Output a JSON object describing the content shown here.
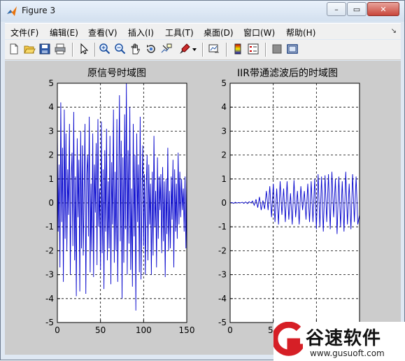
{
  "window": {
    "title": "Figure 3",
    "min_symbol": "–",
    "max_symbol": "▭",
    "close_symbol": "✕"
  },
  "menu": {
    "items": [
      "文件(F)",
      "编辑(E)",
      "查看(V)",
      "插入(I)",
      "工具(T)",
      "桌面(D)",
      "窗口(W)",
      "帮助(H)"
    ],
    "more_symbol": "↘"
  },
  "toolbar": {
    "icons": [
      "new-figure-icon",
      "open-file-icon",
      "save-icon",
      "print-icon",
      "edit-plot-arrow-icon",
      "zoom-in-icon",
      "zoom-out-icon",
      "pan-hand-icon",
      "rotate-3d-icon",
      "data-cursor-icon",
      "brush-icon",
      "brush-dropdown-icon",
      "link-plot-icon",
      "insert-colorbar-icon",
      "insert-legend-icon",
      "hide-plot-tools-icon",
      "show-plot-tools-icon"
    ]
  },
  "chart_data": [
    {
      "type": "line",
      "title": "原信号时域图",
      "xlim": [
        0,
        150
      ],
      "ylim": [
        -5,
        5
      ],
      "xticks": [
        "0",
        "50",
        "100",
        "150"
      ],
      "yticks": [
        "5",
        "4",
        "3",
        "2",
        "1",
        "0",
        "-1",
        "-2",
        "-3",
        "-4",
        "-5"
      ],
      "grid": true,
      "line_color": "#0000cc",
      "series": [
        {
          "x": [
            0,
            1,
            2,
            3,
            4,
            5,
            6,
            7,
            8,
            9,
            10,
            11,
            12,
            13,
            14,
            15,
            16,
            17,
            18,
            19,
            20,
            21,
            22,
            23,
            24,
            25,
            26,
            27,
            28,
            29,
            30,
            31,
            32,
            33,
            34,
            35,
            36,
            37,
            38,
            39,
            40,
            41,
            42,
            43,
            44,
            45,
            46,
            47,
            48,
            49,
            50,
            51,
            52,
            53,
            54,
            55,
            56,
            57,
            58,
            59,
            60,
            61,
            62,
            63,
            64,
            65,
            66,
            67,
            68,
            69,
            70,
            71,
            72,
            73,
            74,
            75,
            76,
            77,
            78,
            79,
            80,
            81,
            82,
            83,
            84,
            85,
            86,
            87,
            88,
            89,
            90,
            91,
            92,
            93,
            94,
            95,
            96,
            97,
            98,
            99,
            100,
            101,
            102,
            103,
            104,
            105,
            106,
            107,
            108,
            109,
            110,
            111,
            112,
            113,
            114,
            115,
            116,
            117,
            118,
            119,
            120,
            121,
            122,
            123,
            124,
            125,
            126,
            127,
            128,
            129,
            130,
            131,
            132,
            133,
            134,
            135,
            136,
            137,
            138,
            139,
            140,
            141,
            142,
            143,
            144,
            145,
            146,
            147,
            148,
            149,
            150
          ],
          "y": [
            3.1,
            -1.2,
            1.6,
            -2.7,
            4.2,
            -0.8,
            2.3,
            -3.3,
            3.9,
            -1.5,
            2.9,
            -2.0,
            1.4,
            -0.5,
            3.3,
            -3.0,
            0.9,
            2.1,
            -1.8,
            3.8,
            -2.4,
            1.1,
            -3.9,
            2.7,
            -0.6,
            1.8,
            -3.7,
            3.0,
            -1.9,
            2.4,
            -2.2,
            0.4,
            3.3,
            -3.8,
            1.2,
            2.0,
            -1.4,
            3.6,
            -2.9,
            0.8,
            -2.0,
            2.9,
            -3.1,
            1.6,
            -0.4,
            2.5,
            -2.6,
            3.5,
            -1.0,
            0.6,
            -2.8,
            3.4,
            -2.1,
            1.4,
            -3.6,
            2.2,
            -1.2,
            3.1,
            -2.4,
            0.9,
            -1.9,
            2.8,
            -3.4,
            1.7,
            -0.9,
            3.9,
            -2.5,
            1.3,
            -2.0,
            3.5,
            -3.3,
            0.7,
            4.5,
            -1.6,
            2.6,
            -4.0,
            1.9,
            -2.5,
            3.7,
            -1.1,
            5.0,
            -3.0,
            2.2,
            -1.7,
            4.0,
            -2.8,
            0.6,
            -3.5,
            3.3,
            -1.4,
            2.0,
            -4.5,
            2.9,
            -0.8,
            1.6,
            -2.9,
            3.6,
            -3.2,
            0.3,
            2.4,
            -1.8,
            1.2,
            -3.0,
            0.5,
            2.0,
            -2.4,
            1.6,
            -0.9,
            0.8,
            -3.0,
            1.3,
            -2.2,
            2.8,
            -1.0,
            0.5,
            -2.7,
            1.9,
            -1.5,
            1.1,
            -0.3,
            1.2,
            -2.1,
            1.5,
            -1.6,
            0.9,
            -3.1,
            1.0,
            -1.3,
            2.3,
            -2.0,
            0.5,
            -1.9,
            1.1,
            -0.7,
            1.8,
            -2.7,
            1.4,
            -1.2,
            0.8,
            -1.5,
            2.1,
            -0.9,
            1.3,
            -0.6,
            1.0,
            -0.3,
            0.6,
            -1.2,
            1.1,
            -1.9,
            1.6
          ]
        }
      ]
    },
    {
      "type": "line",
      "title": "IIR带通滤波后的时域图",
      "xlim": [
        0,
        150
      ],
      "ylim": [
        -5,
        5
      ],
      "xticks": [
        "0",
        "50",
        "100",
        "150"
      ],
      "yticks": [
        "5",
        "4",
        "3",
        "2",
        "1",
        "0",
        "-1",
        "-2",
        "-3",
        "-4",
        "-5"
      ],
      "grid": true,
      "line_color": "#0000cc",
      "series": [
        {
          "x": [
            0,
            2,
            4,
            6,
            8,
            10,
            12,
            14,
            16,
            18,
            20,
            22,
            24,
            26,
            28,
            30,
            32,
            34,
            36,
            38,
            40,
            42,
            44,
            46,
            48,
            50,
            52,
            54,
            56,
            58,
            60,
            62,
            64,
            66,
            68,
            70,
            72,
            74,
            76,
            78,
            80,
            82,
            84,
            86,
            88,
            90,
            92,
            94,
            96,
            98,
            100,
            102,
            104,
            106,
            108,
            110,
            112,
            114,
            116,
            118,
            120,
            122,
            124,
            126,
            128,
            130,
            132,
            134,
            136,
            138,
            140,
            142,
            144,
            146,
            148,
            150
          ],
          "y": [
            0,
            0.02,
            -0.02,
            0.03,
            -0.01,
            0.02,
            0.0,
            0.03,
            -0.02,
            0.04,
            -0.03,
            0.05,
            0.0,
            0.08,
            -0.1,
            0.15,
            -0.2,
            0.25,
            -0.3,
            0.1,
            -0.25,
            0.5,
            -0.3,
            0.7,
            -0.6,
            0.8,
            -0.8,
            0.6,
            -0.9,
            0.9,
            -0.5,
            0.6,
            -0.8,
            0.9,
            -0.7,
            0.4,
            -0.9,
            0.95,
            -0.6,
            0.5,
            -0.9,
            0.7,
            -0.3,
            0.5,
            -0.7,
            0.8,
            -0.8,
            0.9,
            -0.8,
            1.0,
            -1.1,
            1.2,
            -1.0,
            1.1,
            -1.2,
            1.15,
            -0.8,
            1.2,
            -1.1,
            1.3,
            -0.6,
            1.0,
            -1.3,
            1.1,
            -1.0,
            0.9,
            -1.2,
            1.3,
            -0.9,
            0.8,
            -1.1,
            1.2,
            -0.8,
            1.1,
            -0.9,
            -0.5
          ]
        }
      ]
    }
  ],
  "watermark": {
    "name": "谷速软件",
    "url": "www.gusuoft.com",
    "brand_red": "#d61f26"
  }
}
